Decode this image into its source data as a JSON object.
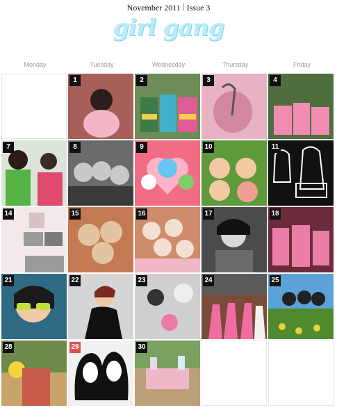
{
  "header": {
    "month": "November 2011",
    "issue": "Issue 3",
    "logo_text": "girl gang"
  },
  "weekdays": [
    "Monday",
    "Tuesday",
    "Wednesday",
    "Thursday",
    "Friday"
  ],
  "days": [
    {
      "label": "1",
      "bg": "#a85f5a",
      "accent": "#f2b6c6"
    },
    {
      "label": "2",
      "bg": "#6c8c58",
      "accent": "#3fb2c9"
    },
    {
      "label": "3",
      "bg": "#e7b3c3",
      "accent": "#d487a3"
    },
    {
      "label": "4",
      "bg": "#4e6e3e",
      "accent": "#f08cb2"
    },
    {
      "label": "7",
      "bg": "#dbe4d8",
      "accent": "#55b244"
    },
    {
      "label": "8",
      "bg": "#6b6b6b",
      "accent": "#c9c9c9"
    },
    {
      "label": "9",
      "bg": "#f26d84",
      "accent": "#63c7ef"
    },
    {
      "label": "10",
      "bg": "#5e9a3a",
      "accent": "#f04e7a"
    },
    {
      "label": "11",
      "bg": "#111111",
      "accent": "#ffffff"
    },
    {
      "label": "14",
      "bg": "#f4e9ea",
      "accent": "#9b9b9b"
    },
    {
      "label": "15",
      "bg": "#c47a52",
      "accent": "#e3c4a1"
    },
    {
      "label": "16",
      "bg": "#cf8c6a",
      "accent": "#f1b7c7"
    },
    {
      "label": "17",
      "bg": "#4b4b4b",
      "accent": "#d8d8d8"
    },
    {
      "label": "18",
      "bg": "#6b2b3a",
      "accent": "#ea7ea7"
    },
    {
      "label": "21",
      "bg": "#2f6a84",
      "accent": "#bfe03a"
    },
    {
      "label": "22",
      "bg": "#d5d5d5",
      "accent": "#111111"
    },
    {
      "label": "23",
      "bg": "#cfcfcf",
      "accent": "#ec7aa6"
    },
    {
      "label": "24",
      "bg": "#7a4a3a",
      "accent": "#f06da4"
    },
    {
      "label": "25",
      "bg": "#5aa2d8",
      "accent": "#e8d23a"
    },
    {
      "label": "28",
      "bg": "#c8a46a",
      "accent": "#f5d33c"
    },
    {
      "label": "29",
      "bg": "#f1f1f1",
      "accent": "#111111",
      "highlight": true
    },
    {
      "label": "30",
      "bg": "#bda07a",
      "accent": "#f0b7c9"
    }
  ]
}
